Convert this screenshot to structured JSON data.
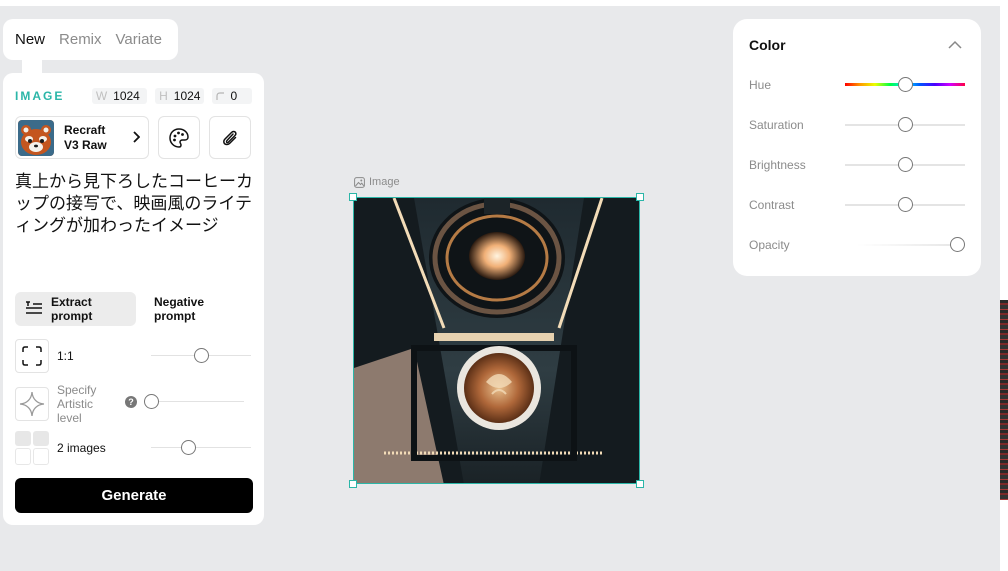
{
  "tabs": [
    {
      "label": "New",
      "active": true
    },
    {
      "label": "Remix",
      "active": false
    },
    {
      "label": "Variate",
      "active": false
    }
  ],
  "image_settings": {
    "section_label": "IMAGE",
    "width_key": "W",
    "width": "1024",
    "height_key": "H",
    "height": "1024",
    "radius": "0"
  },
  "model": {
    "name_line1": "Recraft",
    "name_line2": "V3 Raw",
    "icon": "red-panda-avatar"
  },
  "prompt_text": "真上から見下ろしたコーヒーカップの接写で、映画風のライティングが加わったイメージ",
  "prompt_tabs": {
    "extract": "Extract prompt",
    "negative": "Negative prompt"
  },
  "settings": {
    "ratio_label": "1:1",
    "ratio_slider": 0.5,
    "artistic_label_1": "Specify",
    "artistic_label_2": "Artistic",
    "artistic_label_3": "level",
    "help_glyph": "?",
    "artistic_slider": 0.0,
    "images_label": "2 images",
    "images_slider": 0.35
  },
  "generate_label": "Generate",
  "canvas": {
    "caption": "Image"
  },
  "color_panel": {
    "title": "Color",
    "rows": [
      {
        "label": "Hue",
        "value": 0.5
      },
      {
        "label": "Saturation",
        "value": 0.5
      },
      {
        "label": "Brightness",
        "value": 0.5
      },
      {
        "label": "Contrast",
        "value": 0.5
      },
      {
        "label": "Opacity",
        "value": 1.0
      }
    ]
  },
  "colors": {
    "accent": "#2bb6a8",
    "background": "#e8e9eb",
    "panel": "#ffffff",
    "button": "#000000"
  }
}
